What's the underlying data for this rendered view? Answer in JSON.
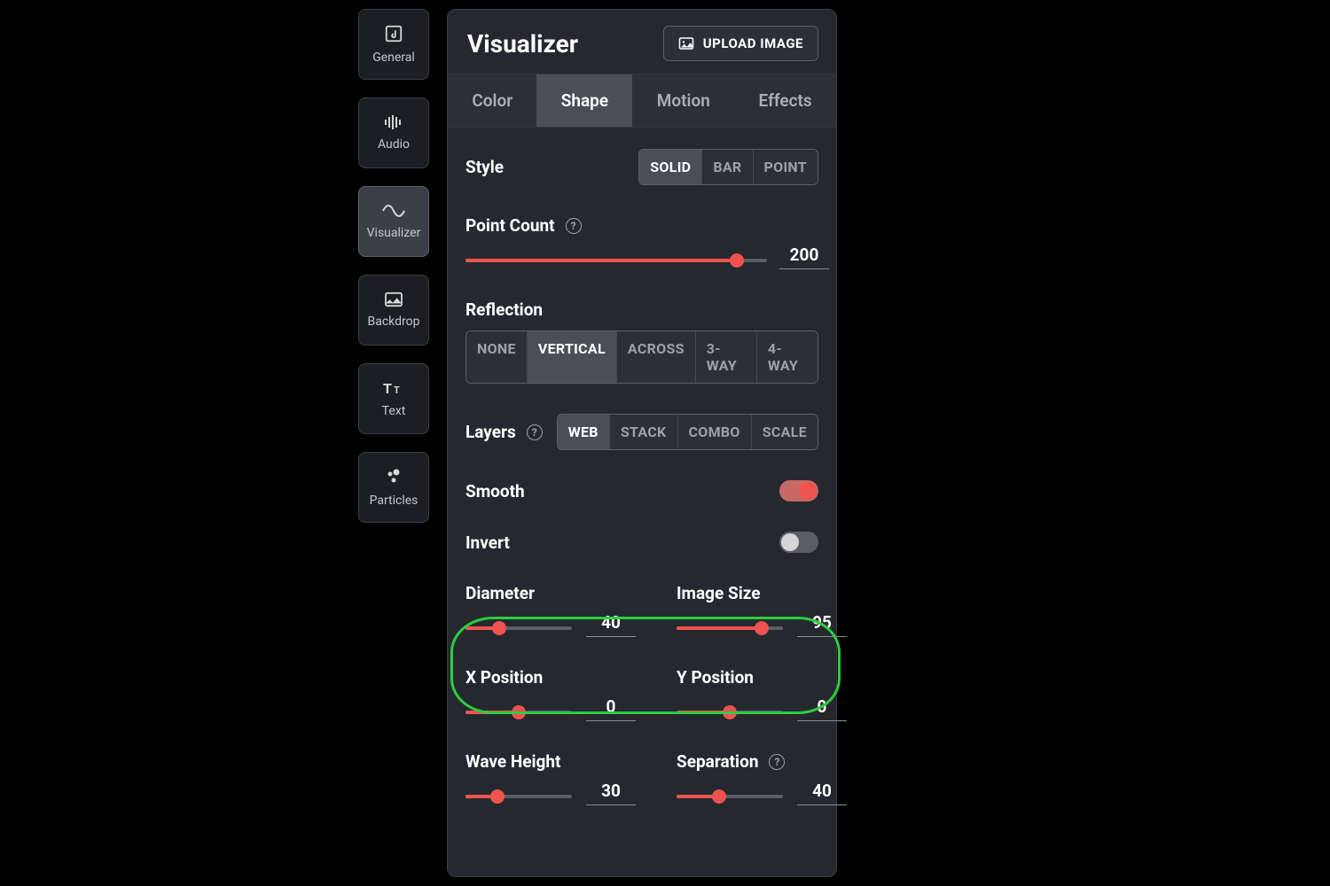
{
  "sidebar": {
    "items": [
      {
        "label": "General"
      },
      {
        "label": "Audio"
      },
      {
        "label": "Visualizer"
      },
      {
        "label": "Backdrop"
      },
      {
        "label": "Text"
      },
      {
        "label": "Particles"
      }
    ],
    "active_index": 2
  },
  "header": {
    "title": "Visualizer",
    "upload_label": "UPLOAD IMAGE"
  },
  "tabs": {
    "items": [
      "Color",
      "Shape",
      "Motion",
      "Effects"
    ],
    "active_index": 1
  },
  "style": {
    "label": "Style",
    "options": [
      "SOLID",
      "BAR",
      "POINT"
    ],
    "active_index": 0
  },
  "point_count": {
    "label": "Point Count",
    "value": 200,
    "percent": 90
  },
  "reflection": {
    "label": "Reflection",
    "options": [
      "NONE",
      "VERTICAL",
      "ACROSS",
      "3-WAY",
      "4-WAY"
    ],
    "active_index": 1
  },
  "layers": {
    "label": "Layers",
    "options": [
      "WEB",
      "STACK",
      "COMBO",
      "SCALE"
    ],
    "active_index": 0
  },
  "smooth": {
    "label": "Smooth",
    "value": true
  },
  "invert": {
    "label": "Invert",
    "value": false
  },
  "diameter": {
    "label": "Diameter",
    "value": 40,
    "percent": 32
  },
  "image_size": {
    "label": "Image Size",
    "value": 95,
    "percent": 80
  },
  "x_position": {
    "label": "X Position",
    "value": 0,
    "percent": 50
  },
  "y_position": {
    "label": "Y Position",
    "value": 0,
    "percent": 50
  },
  "wave_height": {
    "label": "Wave Height",
    "value": 30,
    "percent": 30
  },
  "separation": {
    "label": "Separation",
    "value": 40,
    "percent": 40
  },
  "colors": {
    "accent": "#ef5350",
    "annotation": "#2ecc40"
  }
}
